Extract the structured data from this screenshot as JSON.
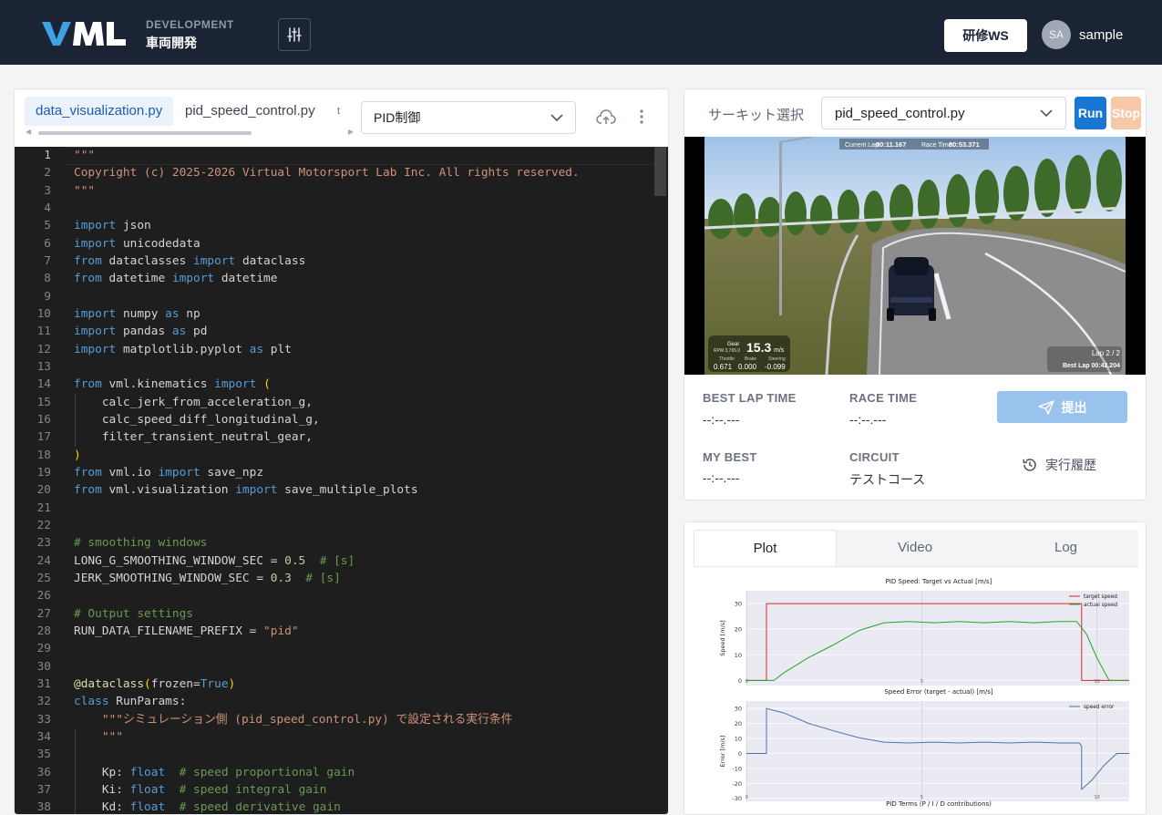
{
  "header": {
    "logo_text": "VML",
    "section_label": "DEVELOPMENT",
    "section_title": "車両開発",
    "workspace_button": "研修WS",
    "avatar_initials": "SA",
    "username": "sample"
  },
  "editor": {
    "tabs": [
      {
        "label": "data_visualization.py",
        "active": true
      },
      {
        "label": "pid_speed_control.py",
        "active": false
      }
    ],
    "tab_overflow": "t",
    "controller_select": "PID制御",
    "current_line": 1,
    "code_lines": [
      [
        [
          "str",
          "\"\"\""
        ]
      ],
      [
        [
          "str",
          "Copyright (c) 2025-2026 Virtual Motorsport Lab Inc. All rights reserved."
        ]
      ],
      [
        [
          "str",
          "\"\"\""
        ]
      ],
      [],
      [
        [
          "kw",
          "import"
        ],
        [
          "t",
          " json"
        ]
      ],
      [
        [
          "kw",
          "import"
        ],
        [
          "t",
          " unicodedata"
        ]
      ],
      [
        [
          "kw",
          "from"
        ],
        [
          "t",
          " dataclasses "
        ],
        [
          "kw",
          "import"
        ],
        [
          "t",
          " dataclass"
        ]
      ],
      [
        [
          "kw",
          "from"
        ],
        [
          "t",
          " datetime "
        ],
        [
          "kw",
          "import"
        ],
        [
          "t",
          " datetime"
        ]
      ],
      [],
      [
        [
          "kw",
          "import"
        ],
        [
          "t",
          " numpy "
        ],
        [
          "kw",
          "as"
        ],
        [
          "t",
          " np"
        ]
      ],
      [
        [
          "kw",
          "import"
        ],
        [
          "t",
          " pandas "
        ],
        [
          "kw",
          "as"
        ],
        [
          "t",
          " pd"
        ]
      ],
      [
        [
          "kw",
          "import"
        ],
        [
          "t",
          " matplotlib.pyplot "
        ],
        [
          "kw",
          "as"
        ],
        [
          "t",
          " plt"
        ]
      ],
      [],
      [
        [
          "kw",
          "from"
        ],
        [
          "t",
          " vml.kinematics "
        ],
        [
          "kw",
          "import"
        ],
        [
          "t",
          " "
        ],
        [
          "br",
          "("
        ]
      ],
      [
        [
          "t",
          "    calc_jerk_from_acceleration_g,"
        ]
      ],
      [
        [
          "t",
          "    calc_speed_diff_longitudinal_g,"
        ]
      ],
      [
        [
          "t",
          "    filter_transient_neutral_gear,"
        ]
      ],
      [
        [
          "br",
          ")"
        ]
      ],
      [
        [
          "kw",
          "from"
        ],
        [
          "t",
          " vml.io "
        ],
        [
          "kw",
          "import"
        ],
        [
          "t",
          " save_npz"
        ]
      ],
      [
        [
          "kw",
          "from"
        ],
        [
          "t",
          " vml.visualization "
        ],
        [
          "kw",
          "import"
        ],
        [
          "t",
          " save_multiple_plots"
        ]
      ],
      [],
      [],
      [
        [
          "cm",
          "# smoothing windows"
        ]
      ],
      [
        [
          "t",
          "LONG_G_SMOOTHING_WINDOW_SEC = "
        ],
        [
          "num",
          "0.5"
        ],
        [
          "t",
          "  "
        ],
        [
          "cm",
          "# [s]"
        ]
      ],
      [
        [
          "t",
          "JERK_SMOOTHING_WINDOW_SEC = "
        ],
        [
          "num",
          "0.3"
        ],
        [
          "t",
          "  "
        ],
        [
          "cm",
          "# [s]"
        ]
      ],
      [],
      [
        [
          "cm",
          "# Output settings"
        ]
      ],
      [
        [
          "t",
          "RUN_DATA_FILENAME_PREFIX = "
        ],
        [
          "str",
          "\"pid\""
        ]
      ],
      [],
      [],
      [
        [
          "dec",
          "@dataclass"
        ],
        [
          "br",
          "("
        ],
        [
          "t",
          "frozen="
        ],
        [
          "kw",
          "True"
        ],
        [
          "br",
          ")"
        ]
      ],
      [
        [
          "kw",
          "class"
        ],
        [
          "t",
          " RunParams:"
        ]
      ],
      [
        [
          "t",
          "    "
        ],
        [
          "str",
          "\"\"\"シミュレーション側 (pid_speed_control.py) で設定される実行条件"
        ]
      ],
      [
        [
          "t",
          "    "
        ],
        [
          "str",
          "\"\"\""
        ]
      ],
      [],
      [
        [
          "t",
          "    Kp: "
        ],
        [
          "kw",
          "float"
        ],
        [
          "t",
          "  "
        ],
        [
          "cm",
          "# speed proportional gain"
        ]
      ],
      [
        [
          "t",
          "    Ki: "
        ],
        [
          "kw",
          "float"
        ],
        [
          "t",
          "  "
        ],
        [
          "cm",
          "# speed integral gain"
        ]
      ],
      [
        [
          "t",
          "    Kd: "
        ],
        [
          "kw",
          "float"
        ],
        [
          "t",
          "  "
        ],
        [
          "cm",
          "# speed derivative gain"
        ]
      ]
    ],
    "colors": {
      "kw": "#569cd6",
      "str": "#ce9178",
      "cm": "#6a9955",
      "num": "#b5cea8",
      "br": "#ffd700",
      "dec": "#dcdcaa",
      "t": "#d4d4d4"
    }
  },
  "run_panel": {
    "circuit_label": "サーキット選択",
    "circuit_select": "pid_speed_control.py",
    "run_button": "Run",
    "stop_button": "Stop",
    "hud": {
      "current_lap_label": "Current Lap:",
      "current_lap": "00:11.167",
      "race_time_label": "Race Time:",
      "race_time": "00:53.371",
      "gear_label": "Gear",
      "rpm_label": "RPM 3,765.0",
      "speed": "15.3",
      "speed_unit": "m/s",
      "throttle_label": "Throttle",
      "brake_label": "Brake",
      "steering_label": "Steering",
      "throttle": "0.671",
      "brake": "0.000",
      "steering": "-0.099",
      "lap": "Lap 2 / 2",
      "best_lap": "Best Lap 00:42.204"
    },
    "stats": {
      "best_lap_label": "BEST LAP TIME",
      "best_lap_value": "--:--.---",
      "race_time_label": "RACE TIME",
      "race_time_value": "--:--.---",
      "my_best_label": "MY BEST",
      "my_best_value": "--:--.---",
      "circuit_label": "CIRCUIT",
      "circuit_value": "テストコース"
    },
    "submit_button": "提出",
    "history_button": "実行履歴"
  },
  "results": {
    "tabs": [
      {
        "label": "Plot",
        "active": true
      },
      {
        "label": "Video",
        "active": false
      },
      {
        "label": "Log",
        "active": false
      }
    ]
  },
  "chart_data": [
    {
      "type": "line",
      "title": "PID Speed: Target vs Actual [m/s]",
      "ylabel": "Speed [m/s]",
      "ylim": [
        -2,
        35
      ],
      "yticks": [
        0,
        10,
        20,
        30
      ],
      "xticks": [
        "0",
        "5",
        "10"
      ],
      "legend_position": "top-right",
      "series": [
        {
          "name": "target speed",
          "color": "#d62728",
          "x": [
            0,
            0.8,
            0.8,
            13.4,
            13.4,
            15.3
          ],
          "y": [
            0,
            0,
            30,
            30,
            0,
            0
          ]
        },
        {
          "name": "actual speed",
          "color": "#2ca02c",
          "x": [
            0,
            1.1,
            1.5,
            2.5,
            3.5,
            4.5,
            5.5,
            6.5,
            7.5,
            8.5,
            9.5,
            10.5,
            11.5,
            12.5,
            13.2,
            13.6,
            14.0,
            14.5,
            15.3
          ],
          "y": [
            0,
            0,
            3,
            9,
            14,
            19.5,
            22.5,
            23,
            22.5,
            23,
            22.5,
            23,
            22.5,
            23,
            23,
            18,
            9,
            0,
            0
          ]
        }
      ]
    },
    {
      "type": "line",
      "title": "Speed Error (target - actual) [m/s]",
      "ylabel": "Error [m/s]",
      "ylim": [
        -32,
        35
      ],
      "yticks": [
        -30,
        -20,
        -10,
        0,
        10,
        20,
        30
      ],
      "xticks": [
        "0",
        "5",
        "10"
      ],
      "legend_position": "top-right",
      "series": [
        {
          "name": "speed error",
          "color": "#4c72b0",
          "x": [
            0,
            0.8,
            0.8,
            1.5,
            2.5,
            3.5,
            4.5,
            5.5,
            6.5,
            7.5,
            8.5,
            9.5,
            10.5,
            11.5,
            12.5,
            13.3,
            13.4,
            13.4,
            13.8,
            14.3,
            14.8,
            15.3
          ],
          "y": [
            0,
            0,
            30,
            27,
            20,
            15,
            10.5,
            7.5,
            7,
            7.5,
            7,
            7.5,
            7,
            7.5,
            7,
            7,
            5,
            -24,
            -18,
            -8,
            0,
            0
          ]
        }
      ]
    },
    {
      "type": "line",
      "title": "PID Terms (P / I / D contributions)",
      "series": []
    }
  ]
}
